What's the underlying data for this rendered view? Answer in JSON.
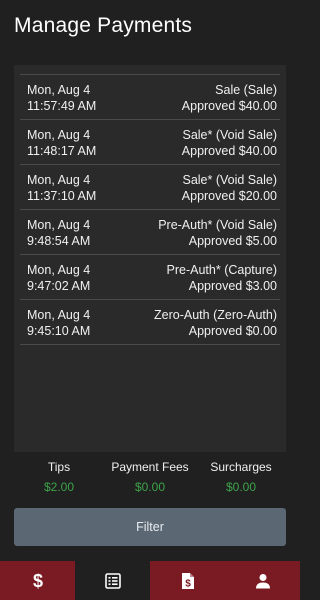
{
  "header": {
    "title": "Manage Payments"
  },
  "transactions": [
    {
      "date": "Mon, Aug 4",
      "time": "11:57:49 AM",
      "type": "Sale (Sale)",
      "status": "Approved $40.00"
    },
    {
      "date": "Mon, Aug 4",
      "time": "11:48:17 AM",
      "type": "Sale* (Void Sale)",
      "status": "Approved $40.00"
    },
    {
      "date": "Mon, Aug 4",
      "time": "11:37:10 AM",
      "type": "Sale* (Void Sale)",
      "status": "Approved $20.00"
    },
    {
      "date": "Mon, Aug 4",
      "time": "9:48:54 AM",
      "type": "Pre-Auth* (Void Sale)",
      "status": "Approved $5.00"
    },
    {
      "date": "Mon, Aug 4",
      "time": "9:47:02 AM",
      "type": "Pre-Auth* (Capture)",
      "status": "Approved $3.00"
    },
    {
      "date": "Mon, Aug 4",
      "time": "9:45:10 AM",
      "type": "Zero-Auth (Zero-Auth)",
      "status": "Approved $0.00"
    }
  ],
  "totals": {
    "tips": {
      "label": "Tips",
      "value": "$2.00"
    },
    "fees": {
      "label": "Payment Fees",
      "value": "$0.00"
    },
    "surcharges": {
      "label": "Surcharges",
      "value": "$0.00"
    }
  },
  "filter": {
    "label": "Filter"
  },
  "nav": {
    "tabs": [
      {
        "icon": "dollar-icon",
        "active": false
      },
      {
        "icon": "list-icon",
        "active": true
      },
      {
        "icon": "invoice-icon",
        "active": false
      },
      {
        "icon": "user-icon",
        "active": false
      }
    ]
  },
  "colors": {
    "background": "#202020",
    "panel": "#2a2a2a",
    "accent_red": "#7a1a22",
    "amount_green": "#3da34a",
    "button": "#5b6773"
  }
}
